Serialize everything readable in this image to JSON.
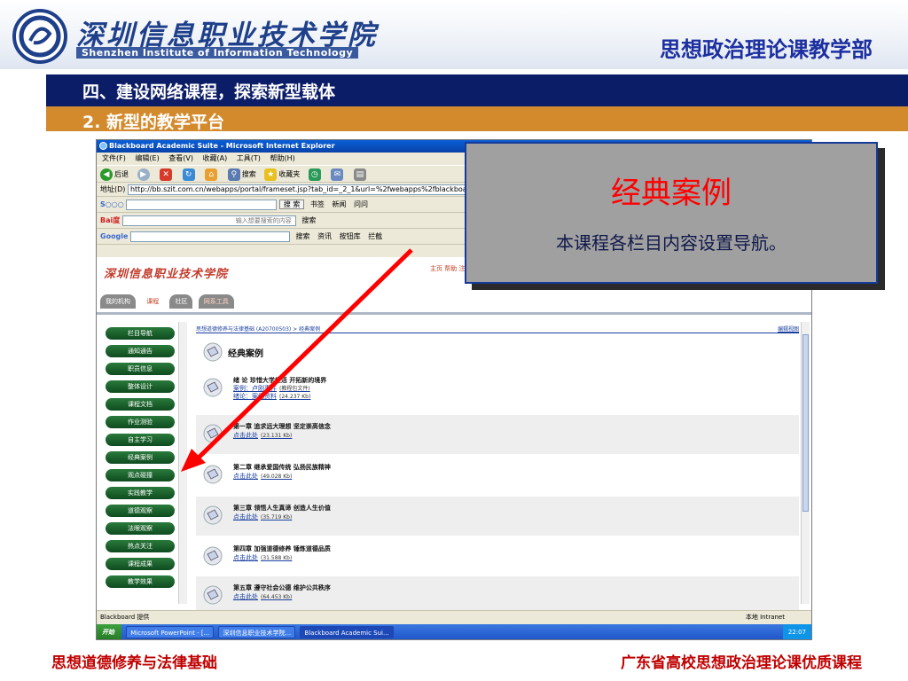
{
  "header": {
    "school_name_cn": "深圳信息职业技术学院",
    "school_name_en": "Shenzhen Institute of Information Technology",
    "dept_name": "思想政治理论课教学部"
  },
  "section_title": "四、建设网络课程，探索新型载体",
  "subsection_title": "2. 新型的教学平台",
  "footer": {
    "left": "思想道德修养与法律基础",
    "right": "广东省高校思想政治理论课优质课程"
  },
  "callout": {
    "title": "经典案例",
    "text": "本课程各栏目内容设置导航。"
  },
  "browser": {
    "window_title": "Blackboard Academic Suite - Microsoft Internet Explorer",
    "menu": [
      "文件(F)",
      "编辑(E)",
      "查看(V)",
      "收藏(A)",
      "工具(T)",
      "帮助(H)"
    ],
    "toolbar": {
      "back": "后退",
      "search": "搜索",
      "favorites": "收藏夹"
    },
    "address_label": "地址(D)",
    "address_url": "http://bb.szit.com.cn/webapps/portal/frameset.jsp?tab_id=_2_1&url=%2fwebapps%2fblackboard%2fexecute%2flaunc",
    "sogou_search": "搜 索",
    "sogou_items": [
      "书签",
      "新闻",
      "问问"
    ],
    "baidu_placeholder": "输入想要搜索的内容",
    "baidu_search": "搜索",
    "google_label": "Google",
    "google_items": [
      "搜索",
      "资讯",
      "按钮库",
      "拦截"
    ],
    "status_text": "Blackboard 提供",
    "status_zone": "本地 Intranet"
  },
  "bb": {
    "logo": "深圳信息职业技术学院",
    "tools": "主页 帮助 注销",
    "tabs": [
      "我的机构",
      "课程",
      "社区",
      "网系工具"
    ],
    "nav_items": [
      "栏目导航",
      "通知通告",
      "职员信息",
      "整体设计",
      "课程文档",
      "作业测验",
      "自主学习",
      "经典案例",
      "观点碰撞",
      "实践教学",
      "道德观察",
      "法眼观察",
      "热点关注",
      "课程成果",
      "教学效果"
    ],
    "breadcrumb": "思想道德修养与法律基础 (A20700503) > 经典案例",
    "edit_view": "编辑视图",
    "page_heading": "经典案例",
    "items": [
      {
        "title": "绪  论  珍惜大学生活  开拓新的境界",
        "links": [
          {
            "text": "案例：卢刚事件",
            "size": "(教程包文件)"
          },
          {
            "text": "绪论：案例资料",
            "size": "(24.237 Kb)"
          }
        ]
      },
      {
        "title": "第一章  追求远大理想  坚定崇高信念",
        "links": [
          {
            "text": "点击此处",
            "size": "(23.131 Kb)"
          }
        ]
      },
      {
        "title": "第二章  继承爱国传统  弘扬民族精神",
        "links": [
          {
            "text": "点击此处",
            "size": "(49.028 Kb)"
          }
        ]
      },
      {
        "title": "第三章  领悟人生真谛  创造人生价值",
        "links": [
          {
            "text": "点击此处",
            "size": "(35.719 Kb)"
          }
        ]
      },
      {
        "title": "第四章  加强道德修养  锤炼道德品质",
        "links": [
          {
            "text": "点击此处",
            "size": "(31.588 Kb)"
          }
        ]
      },
      {
        "title": "第五章  遵守社会公德  维护公共秩序",
        "links": [
          {
            "text": "点击此处",
            "size": "(64.453 Kb)"
          }
        ]
      }
    ]
  },
  "taskbar": {
    "start": "开始",
    "tasks": [
      "Microsoft PowerPoint - [...",
      "深圳信息职业技术学院...",
      "Blackboard Academic Sui..."
    ],
    "clock": "22:07"
  },
  "colors": {
    "navy_band": "#0c1d68",
    "orange_band": "#d38a2c",
    "footer_text": "#c00000",
    "dept_text": "#1c2fa0",
    "callout_title": "#ff0000",
    "callout_border": "#163a9a",
    "arrow": "#ff0000"
  }
}
